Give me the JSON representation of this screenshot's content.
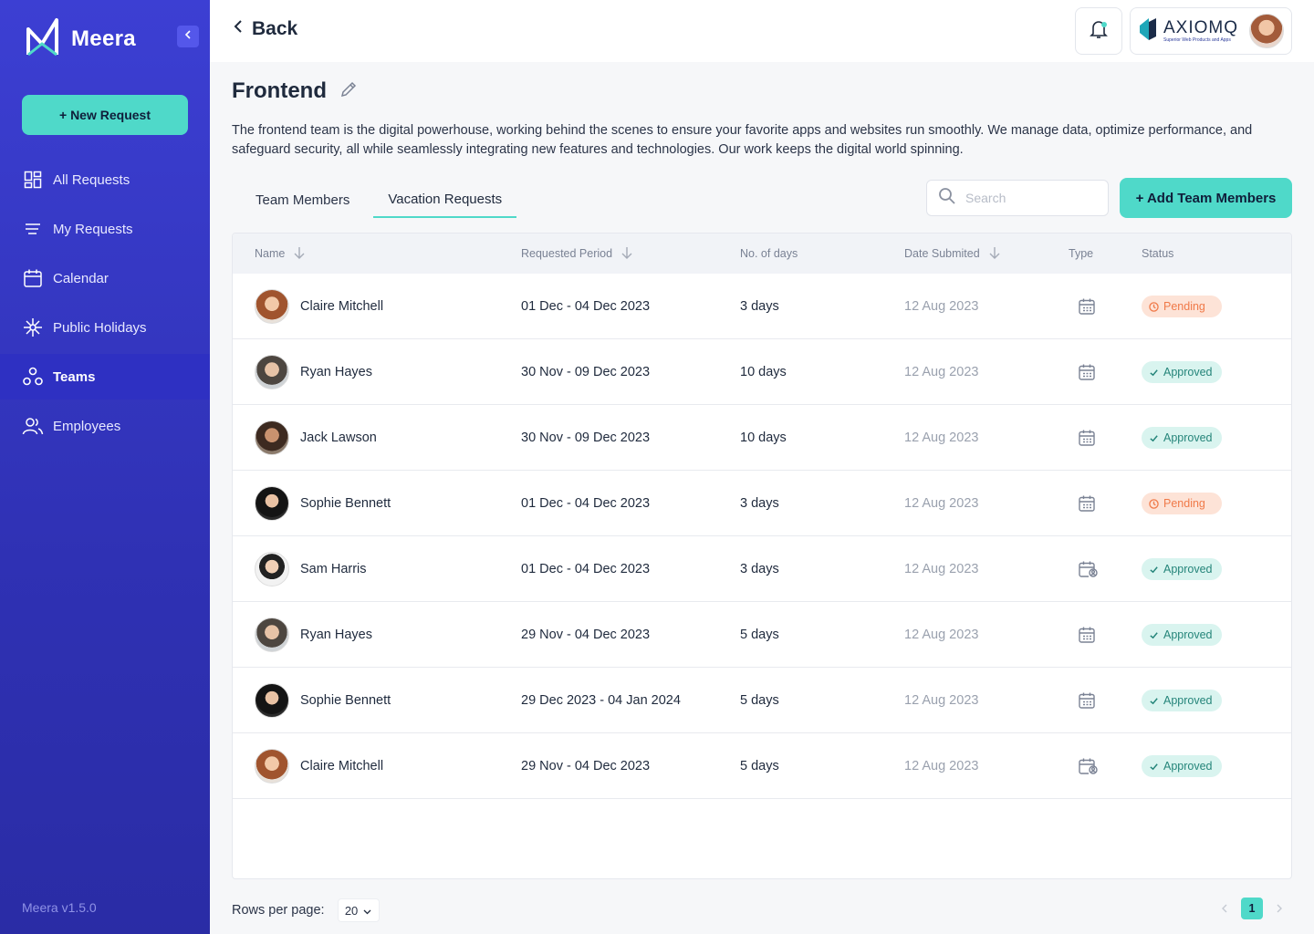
{
  "sidebar": {
    "brand": "Meera",
    "new_request": "+ New Request",
    "items": [
      {
        "label": "All Requests"
      },
      {
        "label": "My Requests"
      },
      {
        "label": "Calendar"
      },
      {
        "label": "Public Holidays"
      },
      {
        "label": "Teams"
      },
      {
        "label": "Employees"
      }
    ],
    "version": "Meera v1.5.0"
  },
  "header": {
    "back_label": "Back",
    "company_name": "AXIOMQ",
    "company_tagline": "Superior Web Products and Apps"
  },
  "page": {
    "title": "Frontend",
    "description": "The frontend team is the digital powerhouse, working behind the scenes to ensure your favorite apps and websites run smoothly. We manage data, optimize performance, and safeguard security, all while seamlessly integrating new features and technologies. Our work keeps the digital world spinning.",
    "tabs": [
      {
        "label": "Team Members"
      },
      {
        "label": "Vacation Requests"
      }
    ],
    "search_placeholder": "Search",
    "add_button": "+ Add Team Members"
  },
  "table": {
    "columns": [
      "Name",
      "Requested Period",
      "No. of days",
      "Date Submited",
      "Type",
      "Status"
    ],
    "rows": [
      {
        "name": "Claire Mitchell",
        "period": "01 Dec - 04 Dec 2023",
        "days": "3 days",
        "submitted": "12 Aug 2023",
        "type_icon": "calendar-icon",
        "status": "Pending"
      },
      {
        "name": "Ryan Hayes",
        "period": "30 Nov - 09 Dec 2023",
        "days": "10 days",
        "submitted": "12 Aug 2023",
        "type_icon": "calendar-icon",
        "status": "Approved"
      },
      {
        "name": "Jack Lawson",
        "period": "30 Nov - 09 Dec 2023",
        "days": "10 days",
        "submitted": "12 Aug 2023",
        "type_icon": "calendar-icon",
        "status": "Approved"
      },
      {
        "name": "Sophie Bennett",
        "period": "01 Dec - 04 Dec 2023",
        "days": "3 days",
        "submitted": "12 Aug 2023",
        "type_icon": "calendar-icon",
        "status": "Pending"
      },
      {
        "name": "Sam Harris",
        "period": "01 Dec - 04 Dec 2023",
        "days": "3 days",
        "submitted": "12 Aug 2023",
        "type_icon": "calendar-user-icon",
        "status": "Approved"
      },
      {
        "name": "Ryan Hayes",
        "period": "29 Nov - 04 Dec 2023",
        "days": "5 days",
        "submitted": "12 Aug 2023",
        "type_icon": "calendar-icon",
        "status": "Approved"
      },
      {
        "name": "Sophie Bennett",
        "period": "29 Dec 2023 - 04 Jan 2024",
        "days": "5 days",
        "submitted": "12 Aug 2023",
        "type_icon": "calendar-icon",
        "status": "Approved"
      },
      {
        "name": "Claire Mitchell",
        "period": "29 Nov - 04 Dec 2023",
        "days": "5 days",
        "submitted": "12 Aug 2023",
        "type_icon": "calendar-user-icon",
        "status": "Approved"
      }
    ]
  },
  "footer": {
    "rows_per_page_label": "Rows per page:",
    "rows_per_page_value": "20",
    "current_page": "1"
  },
  "colors": {
    "accent": "#4fd9c9",
    "sidebar": "#3c3fd3",
    "pending": "#f07a49",
    "approved": "#25857a"
  }
}
